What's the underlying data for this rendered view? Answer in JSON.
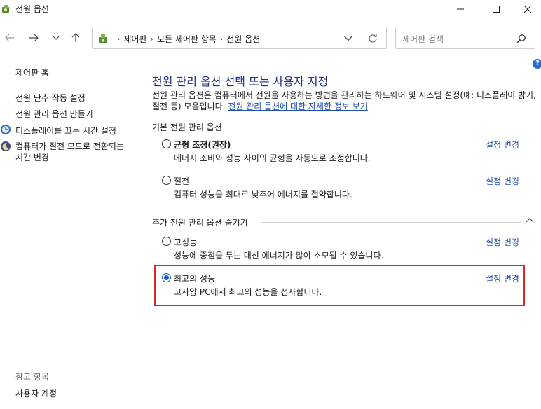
{
  "window": {
    "title": "전원 옵션",
    "icon": "power-options-icon"
  },
  "navigation": {
    "breadcrumbs": [
      "제어판",
      "모든 제어판 항목",
      "전원 옵션"
    ],
    "search_placeholder": "제어판 검색"
  },
  "sidebar": {
    "home": "제어판 홈",
    "items": [
      {
        "label": "전원 단추 작동 설정",
        "icon": null
      },
      {
        "label": "전원 관리 옵션 만들기",
        "icon": null
      },
      {
        "label": "디스플레이를 끄는 시간 설정",
        "icon": "display-timer-icon"
      },
      {
        "label": "컴퓨터가 절전 모드로 전환되는 시간 변경",
        "icon": "sleep-moon-icon"
      }
    ],
    "see_also_heading": "참고 항목",
    "see_also_items": [
      "사용자 계정"
    ]
  },
  "main": {
    "title": "전원 관리 옵션 선택 또는 사용자 지정",
    "description": "전원 관리 옵션은 컴퓨터에서 전원을 사용하는 방법을 관리하는 하드웨어 및 시스템 설정(예: 디스플레이 밝기, 절전 등) 모음입니다. ",
    "learn_more_link": "전원 관리 옵션에 대한 자세한 정보 보기",
    "basic_section_heading": "기본 전원 관리 옵션",
    "extra_section_heading": "추가 전원 관리 옵션 숨기기",
    "change_settings_label": "설정 변경",
    "plans": [
      {
        "name": "균형 조정(권장)",
        "description": "에너지 소비와 성능 사이의 균형을 자동으로 조정합니다.",
        "selected": false,
        "bold": true
      },
      {
        "name": "절전",
        "description": "컴퓨터 성능을 최대로 낮추어 에너지를 절약합니다.",
        "selected": false,
        "bold": false
      },
      {
        "name": "고성능",
        "description": "성능에 중점을 두는 대신 에너지가 많이 소모될 수 있습니다.",
        "selected": false,
        "bold": false
      },
      {
        "name": "최고의 성능",
        "description": "고사양 PC에서 최고의 성능을 선사합니다.",
        "selected": true,
        "bold": false
      }
    ]
  },
  "colors": {
    "link": "#1e4fb0",
    "title": "#1e3287",
    "highlight_border": "#e02424",
    "radio_selected": "#1358c4"
  }
}
